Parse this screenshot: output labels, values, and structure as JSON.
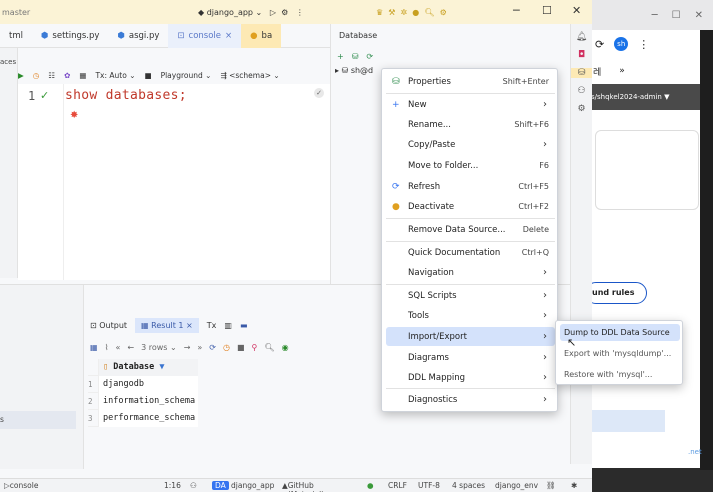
{
  "browser": {
    "nav_label": "»",
    "letter": "sh",
    "url_text": "s/shqkel2024-admin ▼",
    "button": "und rules",
    "side_text": ".net"
  },
  "titlebar": {
    "branch": "master",
    "project": "django_app",
    "minimize": "─",
    "maximize": "☐",
    "close": "✕"
  },
  "tabs": [
    {
      "label": "tml",
      "icon": ""
    },
    {
      "label": "settings.py",
      "icon": "python-icon"
    },
    {
      "label": "asgi.py",
      "icon": "python-icon"
    },
    {
      "label": "console",
      "icon": "console-icon",
      "closable": "×"
    },
    {
      "label": "ba",
      "icon": "db-icon"
    }
  ],
  "left_strip": {
    "label": "aces"
  },
  "editor_toolbar": {
    "tx": "Tx: Auto",
    "playground": "Playground",
    "schema": "<schema>"
  },
  "editor": {
    "line_number": "1",
    "code": "show databases;"
  },
  "db_panel": {
    "title": "Database",
    "tree_item": "sh@d"
  },
  "context_menu": {
    "items": [
      {
        "label": "Properties",
        "shortcut": "Shift+Enter",
        "icon": "properties-icon"
      },
      {
        "label": "New",
        "submenu": true,
        "icon": "plus-icon"
      },
      {
        "label": "Rename...",
        "shortcut": "Shift+F6"
      },
      {
        "label": "Copy/Paste",
        "submenu": true
      },
      {
        "label": "Move to Folder...",
        "shortcut": "F6"
      },
      {
        "label": "Refresh",
        "shortcut": "Ctrl+F5",
        "icon": "refresh-icon"
      },
      {
        "label": "Deactivate",
        "shortcut": "Ctrl+F2",
        "icon": "deactivate-icon"
      },
      {
        "label": "Remove Data Source...",
        "shortcut": "Delete"
      },
      {
        "label": "Quick Documentation",
        "shortcut": "Ctrl+Q"
      },
      {
        "label": "Navigation",
        "submenu": true
      },
      {
        "label": "SQL Scripts",
        "submenu": true
      },
      {
        "label": "Tools",
        "submenu": true
      },
      {
        "label": "Import/Export",
        "submenu": true,
        "highlighted": true
      },
      {
        "label": "Diagrams",
        "submenu": true
      },
      {
        "label": "DDL Mapping",
        "submenu": true
      },
      {
        "label": "Diagnostics",
        "submenu": true
      }
    ]
  },
  "submenu": {
    "items": [
      {
        "label": "Dump to DDL Data Source",
        "highlighted": true
      },
      {
        "label": "Export with 'mysqldump'..."
      },
      {
        "label": "Restore with 'mysql'..."
      }
    ]
  },
  "results": {
    "tabs": [
      "Output",
      "Result 1",
      "Tx"
    ],
    "rows_label": "3 rows",
    "column": "Database",
    "rows": [
      "djangodb",
      "information_schema",
      "performance_schema"
    ],
    "row_numbers": [
      "1",
      "2",
      "3"
    ]
  },
  "bottom_left": {
    "label": "s"
  },
  "statusbar": {
    "console": "console",
    "position": "1:16",
    "project_badge": "DA",
    "project": "django_app",
    "theme": "GitHub (Material)",
    "line_ending": "CRLF",
    "encoding": "UTF-8",
    "indent": "4 spaces",
    "env": "django_env"
  },
  "colors": {
    "accent": "#3574f0",
    "menu_highlight": "#d4e2fb",
    "keyword": "#c0392b"
  }
}
